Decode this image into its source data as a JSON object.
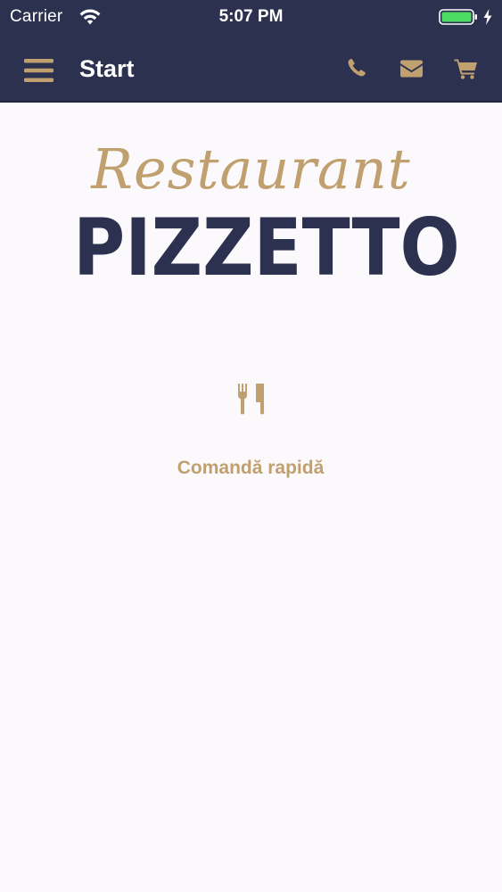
{
  "status_bar": {
    "carrier": "Carrier",
    "time": "5:07 PM",
    "battery_color": "#4cd964"
  },
  "nav": {
    "title": "Start",
    "icons": [
      "menu-icon",
      "phone-icon",
      "mail-icon",
      "cart-icon"
    ],
    "background_color": "#2d3150",
    "accent_color": "#c0a06f"
  },
  "logo": {
    "script_text": "Restaurant",
    "main_text": "PIZZETTO"
  },
  "quick_order": {
    "icon": "cutlery-icon",
    "label": "Comandă rapidă"
  }
}
